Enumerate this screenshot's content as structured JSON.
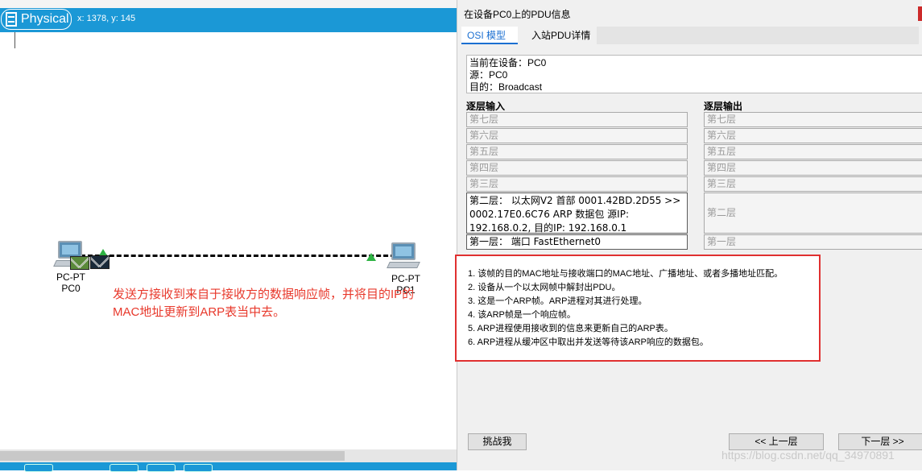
{
  "workspace": {
    "mode_label": "Physical",
    "cursor_coords": "x: 1378, y: 145",
    "devices": [
      {
        "type_label": "PC-PT",
        "name": "PC0"
      },
      {
        "type_label": "PC-PT",
        "name": "PC1"
      }
    ],
    "annotation_line1": "发送方接收到来自于接收方的数据响应帧，并将目的IP的",
    "annotation_line2": "MAC地址更新到ARP表当中去。"
  },
  "dialog": {
    "title": "在设备PC0上的PDU信息",
    "tabs": [
      {
        "label": "OSI 模型",
        "active": true
      },
      {
        "label": "入站PDU详情",
        "active": false
      }
    ],
    "info": {
      "device": "当前在设备：PC0",
      "source": "源：PC0",
      "destination": "目的：Broadcast"
    },
    "in_layers_header": "逐层输入",
    "out_layers_header": "逐层输出",
    "in_layers": [
      "第七层",
      "第六层",
      "第五层",
      "第四层",
      "第三层",
      "第二层：  以太网V2 首部 0001.42BD.2D55 >> 0002.17E0.6C76 ARP 数据包 源IP: 192.168.0.2, 目的IP:  192.168.0.1",
      "第一层：  端口 FastEthernet0"
    ],
    "out_layers": [
      "第七层",
      "第六层",
      "第五层",
      "第四层",
      "第三层",
      "第二层",
      "第一层"
    ],
    "description": [
      "1. 该帧的目的MAC地址与接收端口的MAC地址、广播地址、或者多播地址匹配。",
      "2. 设备从一个以太网帧中解封出PDU。",
      "3. 这是一个ARP帧。ARP进程对其进行处理。",
      "4. 该ARP帧是一个响应帧。",
      "5. ARP进程使用接收到的信息来更新自己的ARP表。",
      "6. ARP进程从缓冲区中取出并发送等待该ARP响应的数据包。"
    ],
    "buttons": {
      "challenge": "挑战我",
      "prev": "<< 上一层",
      "next": "下一层 >>"
    },
    "watermark": "https://blog.csdn.net/qq_34970891"
  },
  "colors": {
    "toolbar_blue": "#1b98d6",
    "annotation_red": "#e8392c",
    "highlight_border": "#e03030",
    "tab_active": "#1b6fd1",
    "link_indicator": "#2fb344"
  }
}
